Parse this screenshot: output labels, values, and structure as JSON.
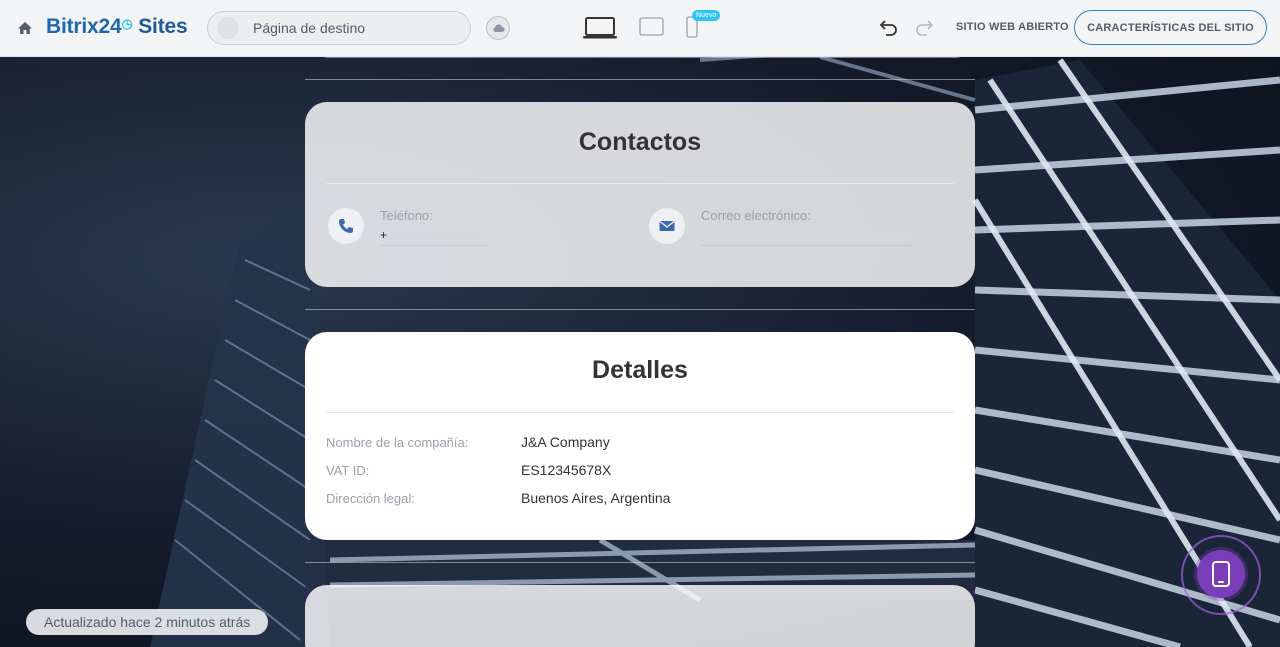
{
  "topbar": {
    "logo_main": "Bitrix24",
    "logo_clock": "◷",
    "logo_sites": "Sites",
    "page_select_value": "Página de destino",
    "new_badge": "Nuevo",
    "open_site_label": "SITIO WEB ABIERTO",
    "features_button_label": "CARACTERÍSTICAS DEL SITIO"
  },
  "contacts": {
    "title": "Contactos",
    "phone_label": "Teléfono:",
    "phone_prefix": "+",
    "email_label": "Correo electrónico:"
  },
  "details": {
    "title": "Detalles",
    "rows": [
      {
        "label": "Nombre de la compañía:",
        "value": "J&A Company"
      },
      {
        "label": "VAT ID:",
        "value": "ES12345678X"
      },
      {
        "label": "Dirección legal:",
        "value": "Buenos Aires, Argentina"
      }
    ]
  },
  "status": {
    "updated_text": "Actualizado hace 2 minutos atrás"
  },
  "colors": {
    "brand_blue": "#2067b0",
    "accent_cyan": "#2fc6f6",
    "fab_purple": "#7a3fb8"
  }
}
